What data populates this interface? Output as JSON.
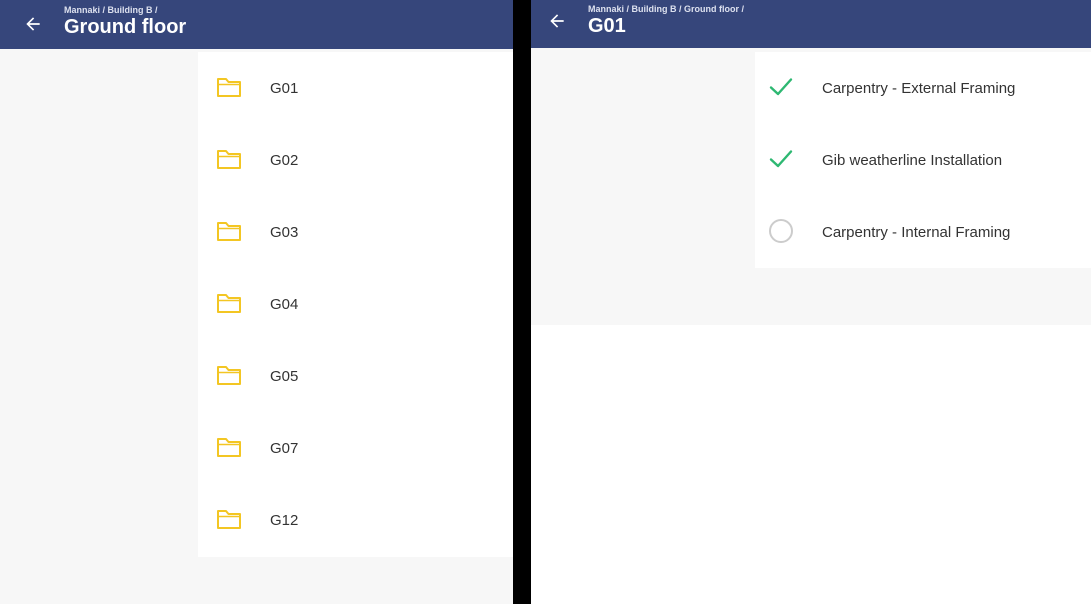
{
  "left_screen": {
    "breadcrumb": "Mannaki / Building B /",
    "title": "Ground floor",
    "folders": [
      {
        "label": "G01"
      },
      {
        "label": "G02"
      },
      {
        "label": "G03"
      },
      {
        "label": "G04"
      },
      {
        "label": "G05"
      },
      {
        "label": "G07"
      },
      {
        "label": "G12"
      }
    ]
  },
  "right_screen": {
    "breadcrumb": "Mannaki / Building B / Ground floor /",
    "title": "G01",
    "tasks": [
      {
        "label": "Carpentry - External Framing",
        "status": "complete"
      },
      {
        "label": "Gib weatherline Installation",
        "status": "complete"
      },
      {
        "label": "Carpentry - Internal Framing",
        "status": "incomplete"
      }
    ]
  },
  "colors": {
    "appbar": "#36467b",
    "folder_icon": "#f3c623",
    "check_icon": "#2eb872",
    "pending_circle": "#cccccc",
    "background": "#f7f7f7"
  }
}
